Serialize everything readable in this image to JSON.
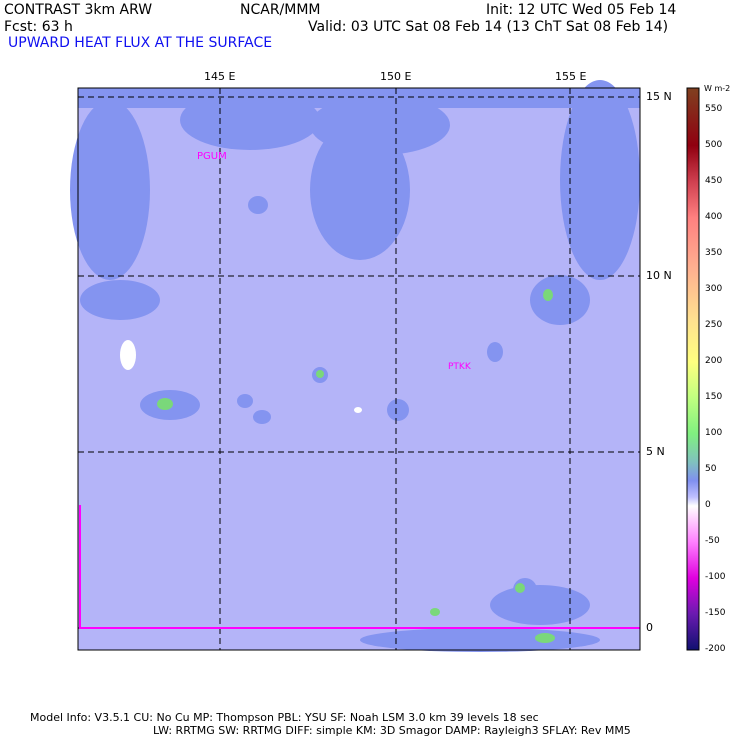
{
  "header": {
    "model": "CONTRAST  3km ARW",
    "org": "NCAR/MMM",
    "init": "Init: 12 UTC Wed 05 Feb 14",
    "fcst": "Fcst:    63 h",
    "valid": "Valid: 03 UTC Sat 08 Feb 14 (13 ChT Sat 08 Feb 14)",
    "field": "UPWARD HEAT FLUX AT THE SURFACE"
  },
  "map": {
    "lon_labels": [
      "145 E",
      "150 E",
      "155 E"
    ],
    "lat_labels": [
      "15 N",
      "10 N",
      "5 N",
      "0"
    ],
    "stations": [
      "PGUM",
      "PTKK"
    ],
    "colors": {
      "background": "#b4b4f8",
      "cloud": "#8494f0",
      "green": "#7ad87a",
      "line": "#ff00ff"
    }
  },
  "colorbar": {
    "units": "W m-2",
    "labels": [
      "550",
      "500",
      "450",
      "400",
      "350",
      "300",
      "250",
      "200",
      "150",
      "100",
      "50",
      "0",
      "-50",
      "-100",
      "-150",
      "-200"
    ],
    "range": [
      -200,
      580
    ],
    "stops": [
      [
        "-200",
        "#101070"
      ],
      [
        "-150",
        "#6a1ab0"
      ],
      [
        "-100",
        "#e000e0"
      ],
      [
        "-50",
        "#ff80ff"
      ],
      [
        "-12",
        "#ffe0ff"
      ],
      [
        "0",
        "#ffffff"
      ],
      [
        "12",
        "#c0c0ff"
      ],
      [
        "35",
        "#8090f0"
      ],
      [
        "60",
        "#80c0c0"
      ],
      [
        "100",
        "#80f080"
      ],
      [
        "150",
        "#c0ff80"
      ],
      [
        "200",
        "#ffff80"
      ],
      [
        "260",
        "#ffe090"
      ],
      [
        "330",
        "#ffb090"
      ],
      [
        "400",
        "#ff8080"
      ],
      [
        "450",
        "#d04050"
      ],
      [
        "500",
        "#900010"
      ],
      [
        "580",
        "#804020"
      ]
    ]
  },
  "footer": {
    "line1": "Model Info: V3.5.1    CU: No Cu    MP: Thompson     PBL: YSU       SF: Noah LSM     3.0 km   39 levels    18 sec",
    "line2": "LW: RRTMG    SW: RRTMG   DIFF: simple KM: 3D Smagor DAMP: Rayleigh3   SFLAY: Rev MM5"
  }
}
